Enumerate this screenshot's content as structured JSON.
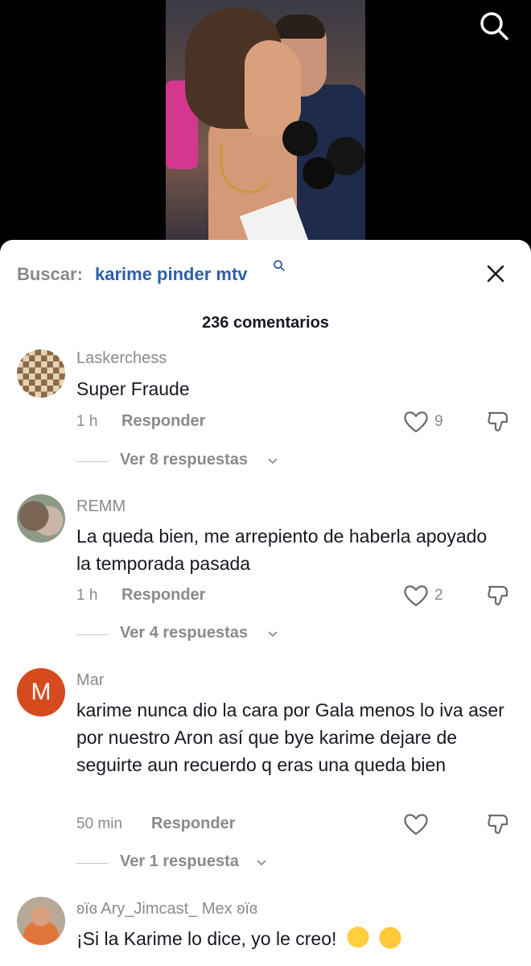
{
  "header": {
    "search_prefix": "Buscar:",
    "search_term": "karime pinder mtv"
  },
  "comments_count": "236 comentarios",
  "comments": [
    {
      "username": "Laskerchess",
      "text": "Super Fraude",
      "time": "1 h",
      "reply_label": "Responder",
      "likes": "9",
      "replies_label": "Ver 8 respuestas"
    },
    {
      "username": "REMM",
      "text": "La queda bien, me arrepiento de haberla apoyado la temporada pasada",
      "time": "1 h",
      "reply_label": "Responder",
      "likes": "2",
      "replies_label": "Ver 4 respuestas"
    },
    {
      "username": "Mar",
      "avatar_letter": "M",
      "text": "karime nunca dio la cara por Gala menos lo iva aser por nuestro Aron así que bye karime dejare de seguirte aun recuerdo q eras una queda bien",
      "time": "50 min",
      "reply_label": "Responder",
      "likes": "",
      "replies_label": "Ver 1 respuesta"
    },
    {
      "username": "ʚïɞ Ary_Jimcast_ Mex ʚïɞ",
      "text": "¡Si la Karime lo dice, yo le creo!"
    }
  ],
  "icons": {
    "top_search": "search-icon",
    "close": "close-icon",
    "like": "heart-icon",
    "dislike": "thumbs-down-icon",
    "chevron": "chevron-down-icon"
  },
  "colors": {
    "search_term": "#2f5fa8",
    "muted": "#8a8a8a",
    "text": "#161823",
    "avatar_m": "#d64b1e"
  }
}
